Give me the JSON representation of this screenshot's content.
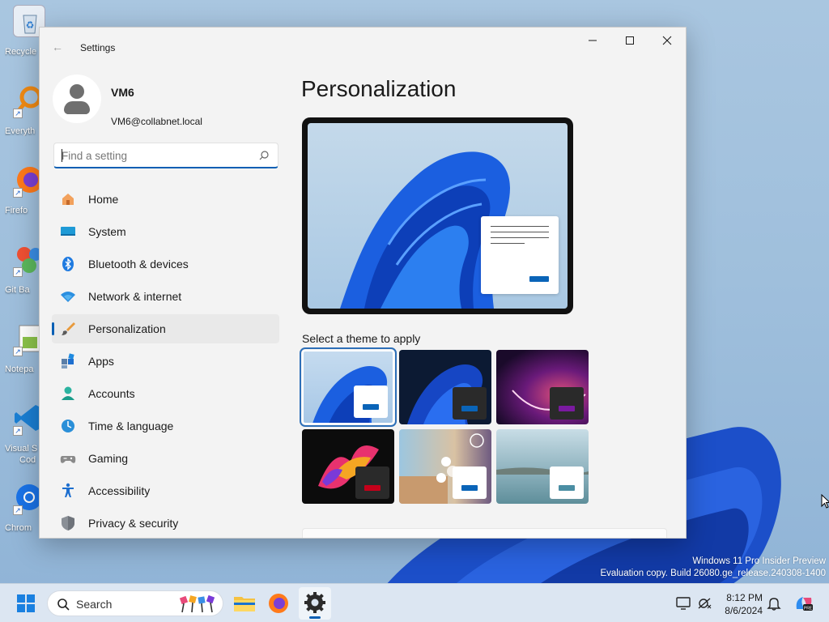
{
  "desktop": {
    "icons": [
      {
        "label": "Recycle Bin",
        "icon": "recycle-bin-icon"
      },
      {
        "label": "Everything",
        "icon": "everything-search-icon"
      },
      {
        "label": "Firefox",
        "icon": "firefox-icon"
      },
      {
        "label": "Git Bash",
        "icon": "git-bash-icon"
      },
      {
        "label": "Notepad++",
        "icon": "notepad-plus-icon"
      },
      {
        "label": "Visual Studio Code",
        "icon": "vscode-icon"
      },
      {
        "label": "Chrome",
        "icon": "chrome-icon"
      }
    ],
    "visible_labels": [
      "Recycle",
      "Everyth",
      "Firefo",
      "Git Ba",
      "Notepa",
      "Visual S",
      "Cod",
      "Chrom"
    ],
    "watermark": {
      "line1": "Windows 11 Pro Insider Preview",
      "line2": "Evaluation copy. Build 26080.ge_release.240308-1400"
    }
  },
  "window": {
    "title": "Settings",
    "controls": [
      "minimize",
      "maximize",
      "close"
    ]
  },
  "sidebar": {
    "profile": {
      "name": "VM6",
      "email": "VM6@collabnet.local"
    },
    "search": {
      "placeholder": "Find a setting"
    },
    "items": [
      {
        "label": "Home",
        "icon": "home-icon",
        "active": false
      },
      {
        "label": "System",
        "icon": "system-icon",
        "active": false
      },
      {
        "label": "Bluetooth & devices",
        "icon": "bluetooth-icon",
        "active": false
      },
      {
        "label": "Network & internet",
        "icon": "network-icon",
        "active": false
      },
      {
        "label": "Personalization",
        "icon": "personalization-brush-icon",
        "active": true
      },
      {
        "label": "Apps",
        "icon": "apps-icon",
        "active": false
      },
      {
        "label": "Accounts",
        "icon": "accounts-icon",
        "active": false
      },
      {
        "label": "Time & language",
        "icon": "time-language-icon",
        "active": false
      },
      {
        "label": "Gaming",
        "icon": "gaming-icon",
        "active": false
      },
      {
        "label": "Accessibility",
        "icon": "accessibility-icon",
        "active": false
      },
      {
        "label": "Privacy & security",
        "icon": "privacy-shield-icon",
        "active": false
      }
    ]
  },
  "main": {
    "title": "Personalization",
    "theme_section_label": "Select a theme to apply",
    "themes": [
      {
        "name": "windows-light",
        "selected": true,
        "accent": "#0a64b8"
      },
      {
        "name": "windows-dark",
        "selected": false,
        "accent": "#0a64b8"
      },
      {
        "name": "glow",
        "selected": false,
        "accent": "#7a1aa0"
      },
      {
        "name": "captured-motion",
        "selected": false,
        "accent": "#c4001a"
      },
      {
        "name": "sunrise",
        "selected": false,
        "accent": "#0a64b8"
      },
      {
        "name": "flow",
        "selected": false,
        "accent": "#4b8ea3"
      }
    ]
  },
  "taskbar": {
    "search_label": "Search",
    "apps": [
      "start-icon",
      "search",
      "file-explorer-icon",
      "firefox-icon",
      "settings-gear-icon"
    ],
    "active_app": "settings-gear-icon",
    "clock": {
      "time": "8:12 PM",
      "date": "8/6/2024"
    }
  },
  "colors": {
    "accent": "#0a5fb4",
    "window_bg": "#f3f3f3",
    "taskbar_bg": "#dce6f2"
  }
}
